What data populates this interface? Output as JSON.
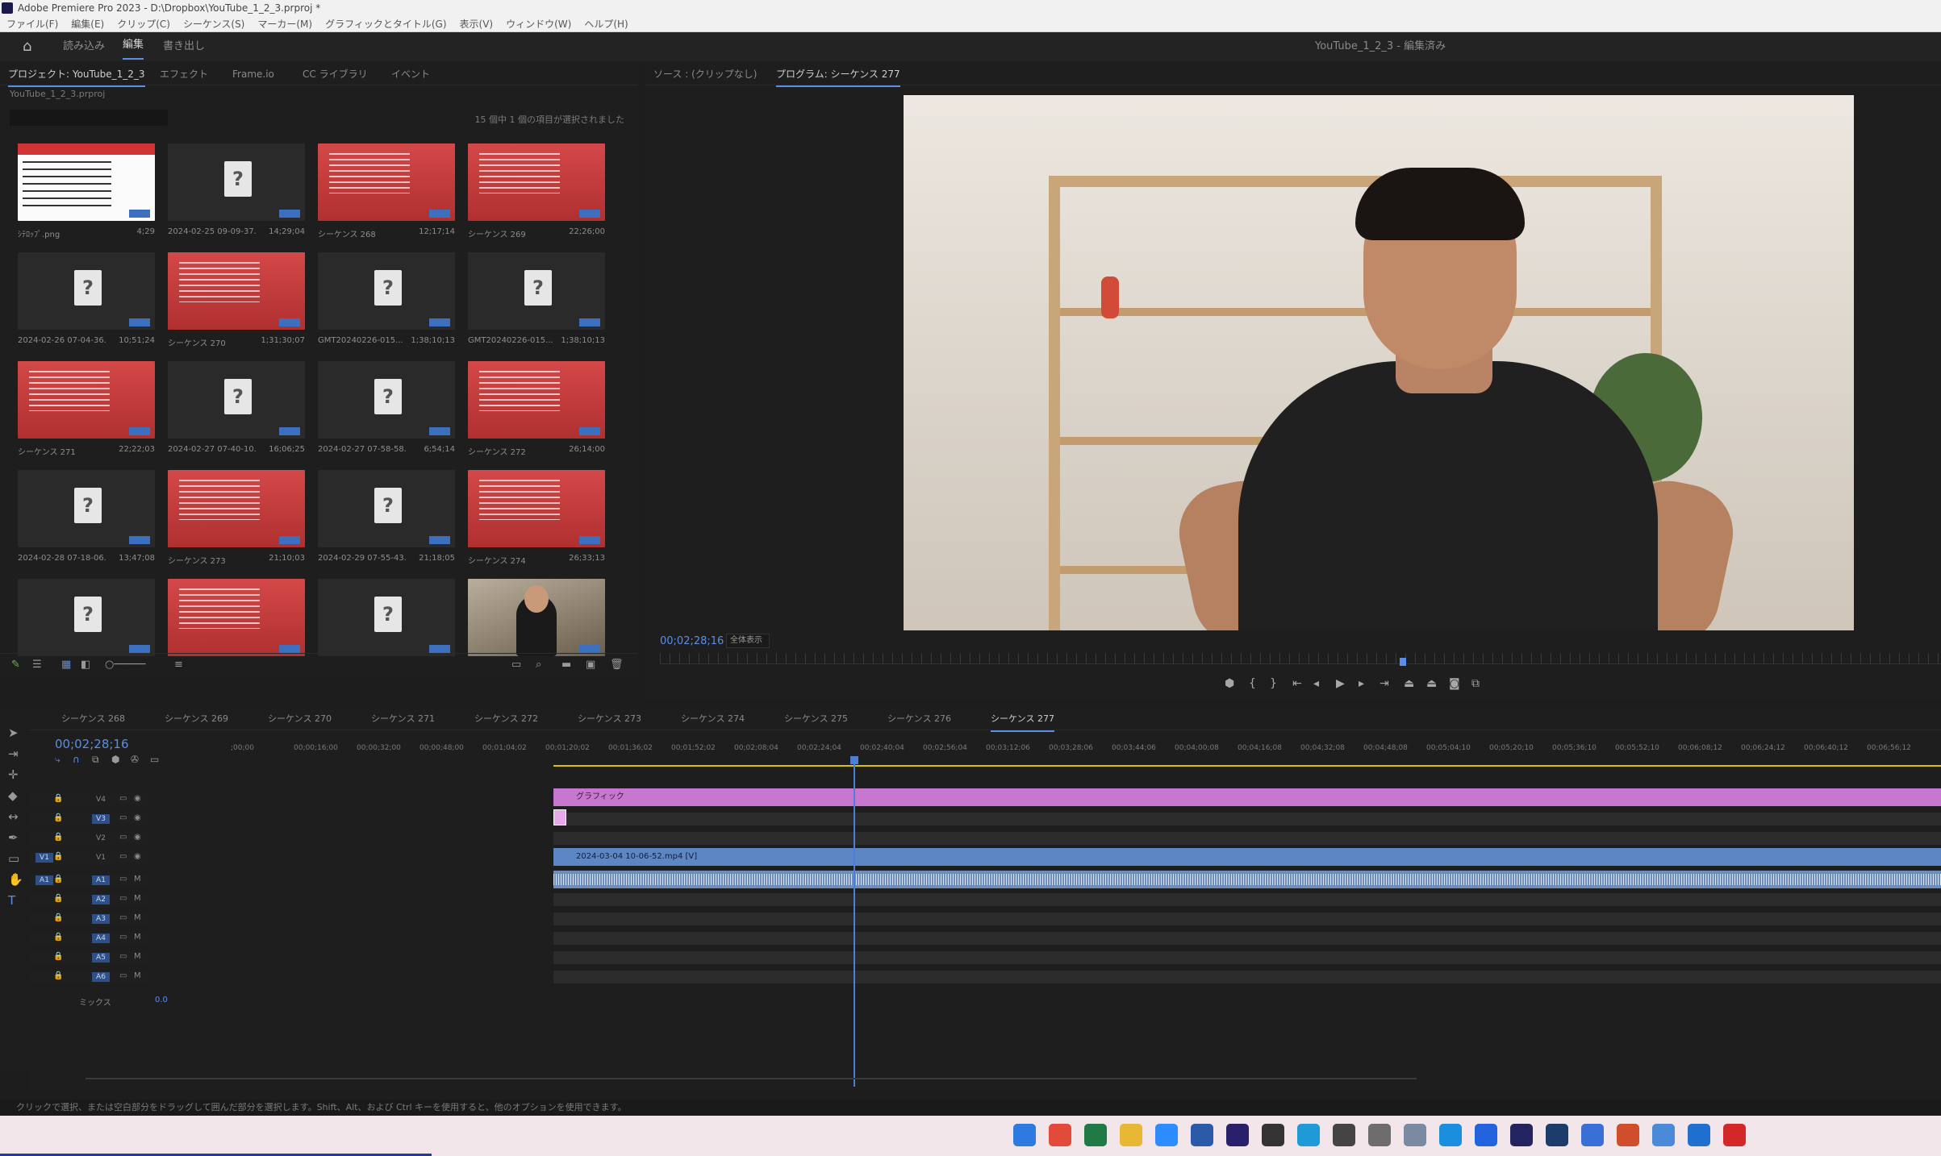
{
  "titlebar": {
    "title": "Adobe Premiere Pro 2023 - D:\\Dropbox\\YouTube_1_2_3.prproj *"
  },
  "menu": [
    "ファイル(F)",
    "編集(E)",
    "クリップ(C)",
    "シーケンス(S)",
    "マーカー(M)",
    "グラフィックとタイトル(G)",
    "表示(V)",
    "ウィンドウ(W)",
    "ヘルプ(H)"
  ],
  "workspace": {
    "tabs": [
      "読み込み",
      "編集",
      "書き出し"
    ],
    "active": "編集",
    "doc_title": "YouTube_1_2_3 - 編集済み"
  },
  "project_panel": {
    "tabs": [
      "プロジェクト: YouTube_1_2_3",
      "エフェクト",
      "Frame.io",
      "CC ライブラリ",
      "イベント"
    ],
    "path": "YouTube_1_2_3.prproj",
    "selection_count": "15 個中 1 個の項目が選択されました",
    "items": [
      {
        "name": "ｼﾃﾛｯﾌﾟ.png",
        "duration": "4;29",
        "type": "white"
      },
      {
        "name": "2024-02-25 09-09-37...",
        "duration": "14;29;04",
        "type": "missing"
      },
      {
        "name": "シーケンス 268",
        "duration": "12;17;14",
        "type": "red"
      },
      {
        "name": "シーケンス 269",
        "duration": "22;26;00",
        "type": "red"
      },
      {
        "name": "2024-02-26 07-04-36...",
        "duration": "10;51;24",
        "type": "missing"
      },
      {
        "name": "シーケンス 270",
        "duration": "1;31;30;07",
        "type": "red"
      },
      {
        "name": "GMT20240226-015...",
        "duration": "1;38;10;13",
        "type": "missing"
      },
      {
        "name": "GMT20240226-015...",
        "duration": "1;38;10;13",
        "type": "missing"
      },
      {
        "name": "シーケンス 271",
        "duration": "22;22;03",
        "type": "red"
      },
      {
        "name": "2024-02-27 07-40-10...",
        "duration": "16;06;25",
        "type": "missing"
      },
      {
        "name": "2024-02-27 07-58-58...",
        "duration": "6;54;14",
        "type": "missing"
      },
      {
        "name": "シーケンス 272",
        "duration": "26;14;00",
        "type": "red"
      },
      {
        "name": "2024-02-28 07-18-06...",
        "duration": "13;47;08",
        "type": "missing"
      },
      {
        "name": "シーケンス 273",
        "duration": "21;10;03",
        "type": "red"
      },
      {
        "name": "2024-02-29 07-55-43...",
        "duration": "21;18;05",
        "type": "missing"
      },
      {
        "name": "シーケンス 274",
        "duration": "26;33;13",
        "type": "red"
      },
      {
        "name": "",
        "duration": "",
        "type": "missing"
      },
      {
        "name": "",
        "duration": "",
        "type": "red"
      },
      {
        "name": "",
        "duration": "",
        "type": "missing"
      },
      {
        "name": "",
        "duration": "",
        "type": "photo"
      }
    ]
  },
  "program_monitor": {
    "tabs": [
      "ソース : (クリップなし)",
      "プログラム: シーケンス 277"
    ],
    "timecode": "00;02;28;16",
    "fit": "全体表示"
  },
  "timeline": {
    "tabs": [
      "シーケンス 268",
      "シーケンス 269",
      "シーケンス 270",
      "シーケンス 271",
      "シーケンス 272",
      "シーケンス 273",
      "シーケンス 274",
      "シーケンス 275",
      "シーケンス 276",
      "シーケンス 277"
    ],
    "active_tab": "シーケンス 277",
    "timecode": "00;02;28;16",
    "ruler": [
      ";00;00",
      "00;00;16;00",
      "00;00;32;00",
      "00;00;48;00",
      "00;01;04;02",
      "00;01;20;02",
      "00;01;36;02",
      "00;01;52;02",
      "00;02;08;04",
      "00;02;24;04",
      "00;02;40;04",
      "00;02;56;04",
      "00;03;12;06",
      "00;03;28;06",
      "00;03;44;06",
      "00;04;00;08",
      "00;04;16;08",
      "00;04;32;08",
      "00;04;48;08",
      "00;05;04;10",
      "00;05;20;10",
      "00;05;36;10",
      "00;05;52;10",
      "00;06;08;12",
      "00;06;24;12",
      "00;06;40;12",
      "00;06;56;12"
    ],
    "video_tracks": [
      "V4",
      "V3",
      "V2",
      "V1"
    ],
    "audio_tracks": [
      "A1",
      "A2",
      "A3",
      "A4",
      "A5",
      "A6"
    ],
    "mix_label": "ミックス",
    "mix_value": "0.0",
    "clip_graphic": "グラフィック",
    "clip_video": "2024-03-04 10-06-52.mp4 [V]"
  },
  "status_bar": "クリックで選択、または空白部分をドラッグして囲んだ部分を選択します。Shift、Alt、および Ctrl キーを使用すると、他のオプションを使用できます。",
  "taskbar_icons": [
    {
      "name": "windows-start-icon",
      "color": "#2d7ae0"
    },
    {
      "name": "chrome-icon",
      "color": "#e24a3b"
    },
    {
      "name": "excel-icon",
      "color": "#1f7a45"
    },
    {
      "name": "explorer-icon",
      "color": "#e8b733"
    },
    {
      "name": "zoom-icon",
      "color": "#2d8cff"
    },
    {
      "name": "word-icon",
      "color": "#2b5aa8"
    },
    {
      "name": "premiere-icon",
      "color": "#2a1f6a"
    },
    {
      "name": "app-icon",
      "color": "#333333"
    },
    {
      "name": "edge-icon",
      "color": "#1e9ad6"
    },
    {
      "name": "notion-icon",
      "color": "#444444"
    },
    {
      "name": "settings-icon",
      "color": "#6d6d6d"
    },
    {
      "name": "app2-icon",
      "color": "#7a8aa0"
    },
    {
      "name": "skype-icon",
      "color": "#1a8fe0"
    },
    {
      "name": "dropbox-icon",
      "color": "#2363de"
    },
    {
      "name": "media-encoder-icon",
      "color": "#23245f"
    },
    {
      "name": "photoshop-icon",
      "color": "#1e3c6a"
    },
    {
      "name": "app3-icon",
      "color": "#3b6fd8"
    },
    {
      "name": "powerpoint-icon",
      "color": "#d04e2c"
    },
    {
      "name": "app4-icon",
      "color": "#4b8ad8"
    },
    {
      "name": "mail-icon",
      "color": "#1f6fd1"
    },
    {
      "name": "acrobat-icon",
      "color": "#d3272a"
    }
  ]
}
